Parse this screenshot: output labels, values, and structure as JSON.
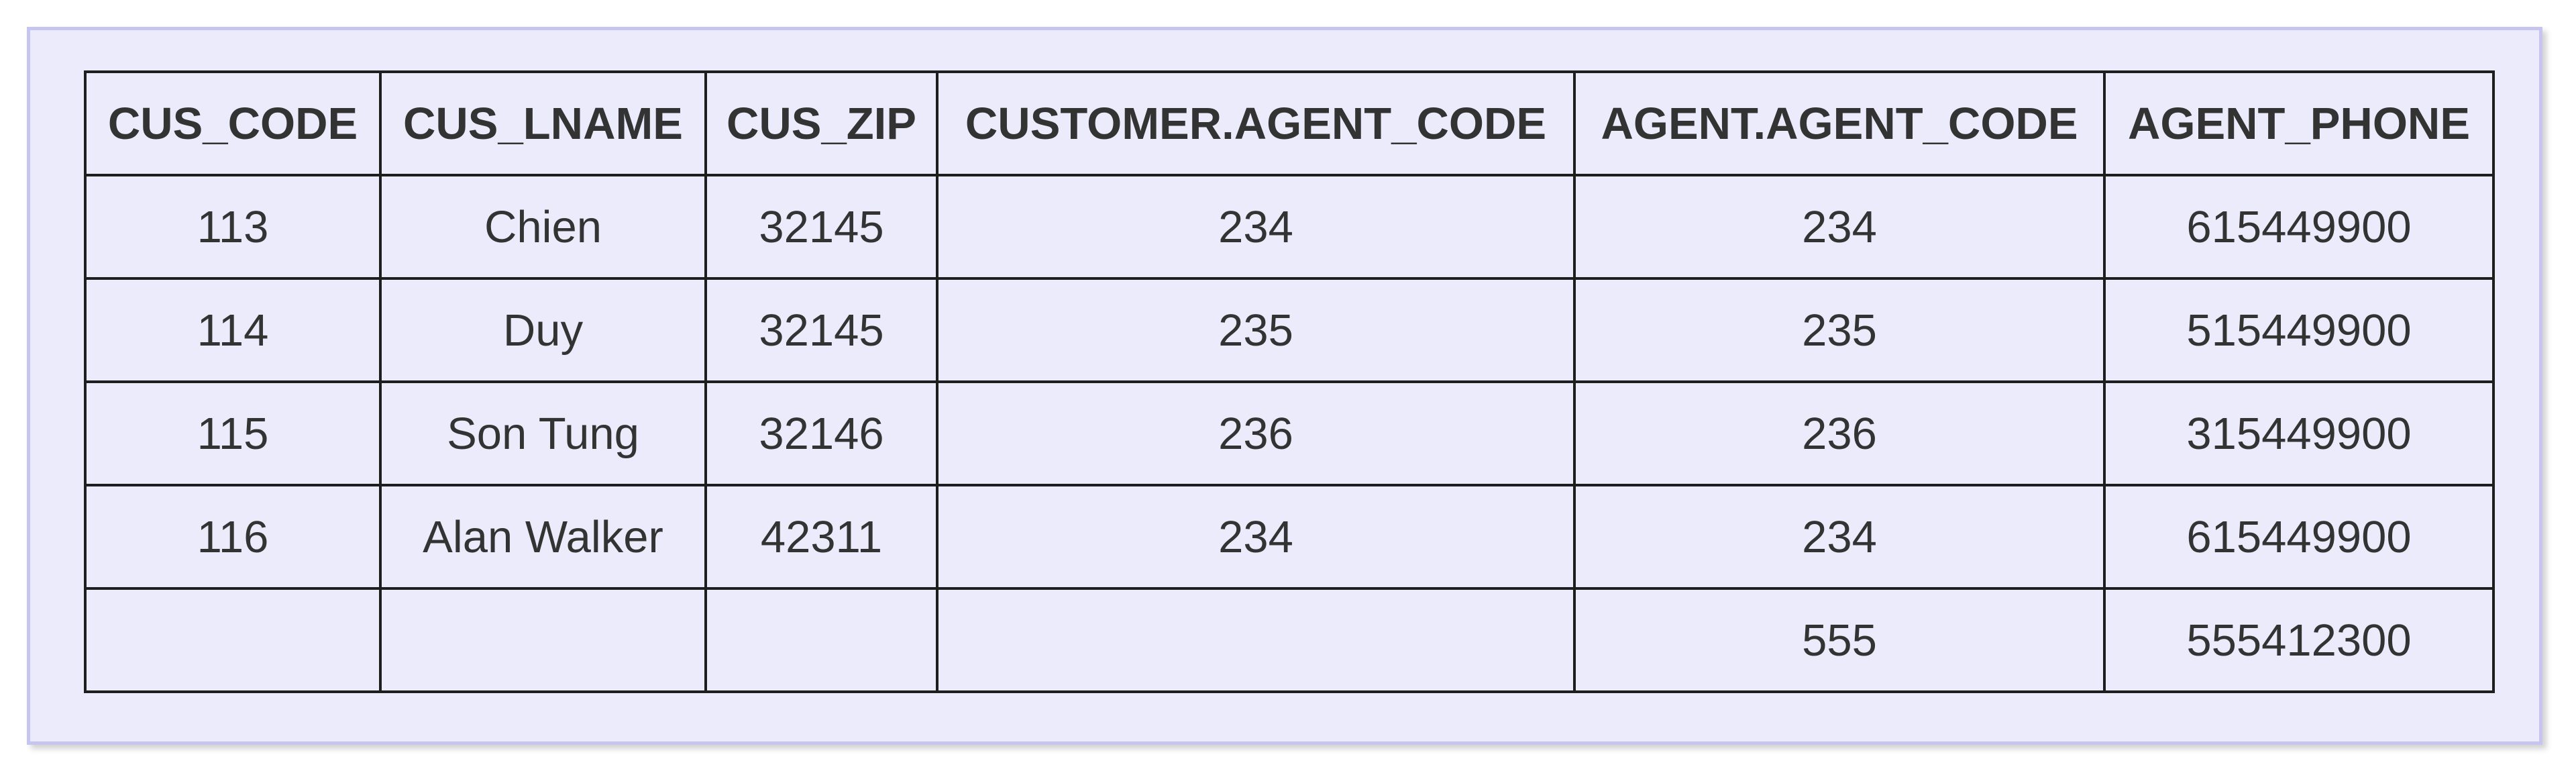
{
  "table": {
    "columns": [
      "CUS_CODE",
      "CUS_LNAME",
      "CUS_ZIP",
      "CUSTOMER.AGENT_CODE",
      "AGENT.AGENT_CODE",
      "AGENT_PHONE"
    ],
    "rows": [
      [
        "113",
        "Chien",
        "32145",
        "234",
        "234",
        "615449900"
      ],
      [
        "114",
        "Duy",
        "32145",
        "235",
        "235",
        "515449900"
      ],
      [
        "115",
        "Son Tung",
        "32146",
        "236",
        "236",
        "315449900"
      ],
      [
        "116",
        "Alan Walker",
        "42311",
        "234",
        "234",
        "615449900"
      ],
      [
        "",
        "",
        "",
        "",
        "555",
        "555412300"
      ]
    ]
  },
  "colors": {
    "panel_background": "#ebebfb",
    "panel_border": "#c5c5ef",
    "grid_line": "#1e1e1e",
    "text": "#333333"
  }
}
